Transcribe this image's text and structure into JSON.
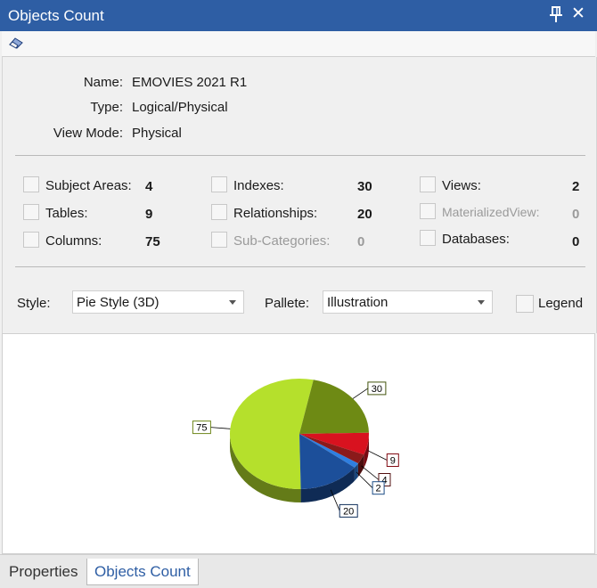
{
  "window": {
    "title": "Objects Count"
  },
  "info": {
    "name_label": "Name:",
    "name_value": "EMOVIES 2021 R1",
    "type_label": "Type:",
    "type_value": "Logical/Physical",
    "viewmode_label": "View Mode:",
    "viewmode_value": "Physical"
  },
  "counts": {
    "subject_areas": {
      "label": "Subject Areas:",
      "value": "4"
    },
    "tables": {
      "label": "Tables:",
      "value": "9"
    },
    "columns": {
      "label": "Columns:",
      "value": "75"
    },
    "indexes": {
      "label": "Indexes:",
      "value": "30"
    },
    "relationships": {
      "label": "Relationships:",
      "value": "20"
    },
    "sub_categories": {
      "label": "Sub-Categories:",
      "value": "0"
    },
    "views": {
      "label": "Views:",
      "value": "2"
    },
    "materialized_view": {
      "label": "MaterializedView:",
      "value": "0"
    },
    "databases": {
      "label": "Databases:",
      "value": "0"
    }
  },
  "options": {
    "style_label": "Style:",
    "style_value": "Pie Style (3D)",
    "pallete_label": "Pallete:",
    "pallete_value": "Illustration",
    "legend_label": "Legend"
  },
  "chart_data": {
    "type": "pie",
    "series": [
      {
        "name": "Columns",
        "value": 75,
        "color": "#b5e02c"
      },
      {
        "name": "Indexes",
        "value": 30,
        "color": "#6e8a14"
      },
      {
        "name": "Tables",
        "value": 9,
        "color": "#d8121f"
      },
      {
        "name": "Subject Areas",
        "value": 4,
        "color": "#8b1a1a"
      },
      {
        "name": "Views",
        "value": 2,
        "color": "#2f7fe0"
      },
      {
        "name": "Relationships",
        "value": 20,
        "color": "#1c4f9a"
      }
    ],
    "labels": [
      "75",
      "30",
      "9",
      "4",
      "2",
      "20"
    ]
  },
  "tabs": [
    {
      "label": "Properties",
      "active": false
    },
    {
      "label": "Objects Count",
      "active": true
    }
  ]
}
